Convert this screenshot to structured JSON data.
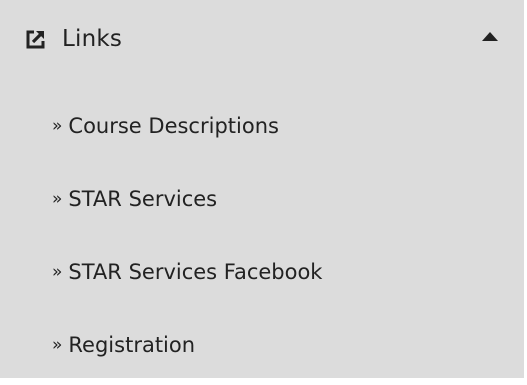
{
  "section": {
    "title": "Links",
    "icon": "external-link-icon",
    "toggle_icon": "caret-up-icon",
    "expanded": true
  },
  "links": {
    "bullet": "»",
    "items": [
      {
        "label": "Course Descriptions"
      },
      {
        "label": "STAR Services"
      },
      {
        "label": "STAR Services Facebook"
      },
      {
        "label": "Registration"
      }
    ]
  },
  "colors": {
    "panel_background": "#dcdcdc",
    "text": "#222222"
  }
}
